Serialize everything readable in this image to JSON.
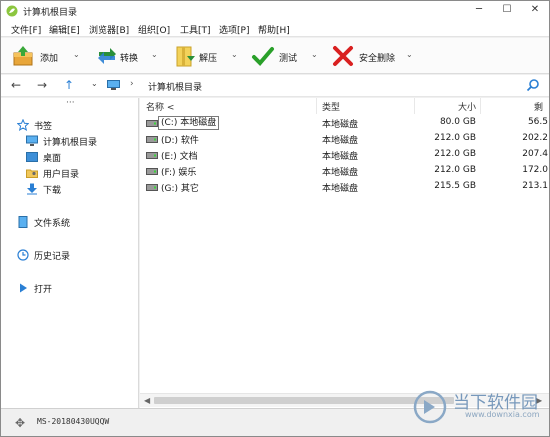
{
  "window": {
    "title": "计算机根目录"
  },
  "menu": [
    "文件[F]",
    "编辑[E]",
    "浏览器[B]",
    "组织[O]",
    "工具[T]",
    "选项[P]",
    "帮助[H]"
  ],
  "toolbar": {
    "add": "添加",
    "convert": "转换",
    "extract": "解压",
    "test": "测试",
    "secure_delete": "安全删除"
  },
  "address": {
    "path": "计算机根目录"
  },
  "sidebar": {
    "bookmarks": "书签",
    "items": [
      "计算机根目录",
      "桌面",
      "用户目录",
      "下载"
    ],
    "filesystem": "文件系统",
    "history": "历史记录",
    "open": "打开"
  },
  "columns": {
    "name": "名称 <",
    "type": "类型",
    "size": "大小",
    "free": "剩"
  },
  "rows": [
    {
      "name": "(C:) 本地磁盘",
      "type": "本地磁盘",
      "size": "80.0 GB",
      "free": "56.5"
    },
    {
      "name": "(D:) 软件",
      "type": "本地磁盘",
      "size": "212.0 GB",
      "free": "202.2"
    },
    {
      "name": "(E:) 文档",
      "type": "本地磁盘",
      "size": "212.0 GB",
      "free": "207.4"
    },
    {
      "name": "(F:) 娱乐",
      "type": "本地磁盘",
      "size": "212.0 GB",
      "free": "172.0"
    },
    {
      "name": "(G:) 其它",
      "type": "本地磁盘",
      "size": "215.5 GB",
      "free": "213.1"
    }
  ],
  "status": {
    "text": "MS-20180430UQQW"
  },
  "watermark": {
    "text": "当下软件园",
    "url": "www.downxia.com"
  },
  "colors": {
    "accent": "#2a7fd4",
    "title_bg": "#ffffff",
    "toolbar_bg": "#fbfbfb"
  }
}
